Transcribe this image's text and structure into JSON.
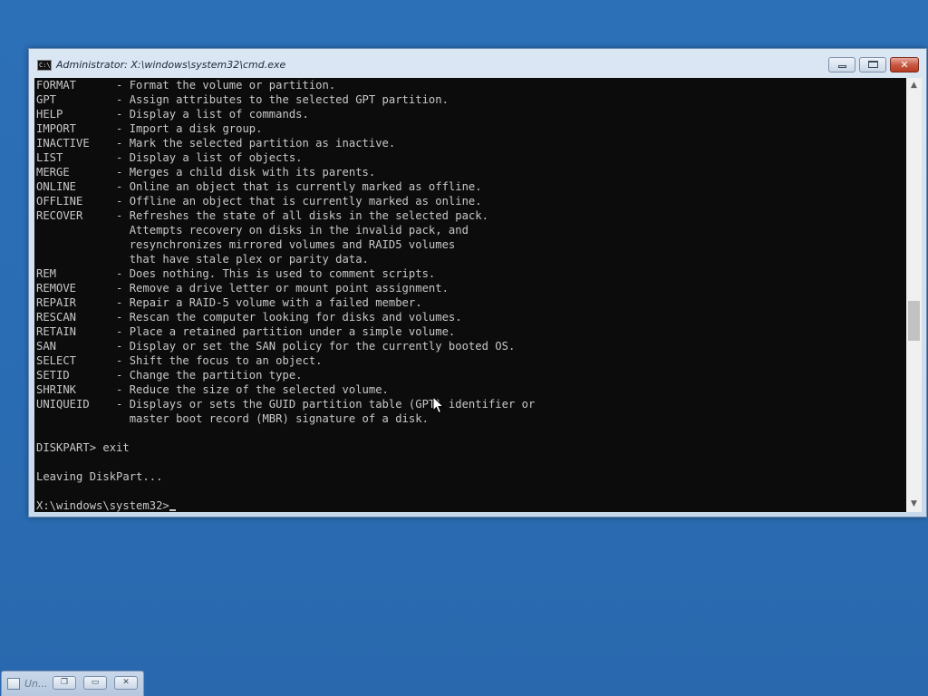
{
  "window": {
    "title": "Administrator: X:\\windows\\system32\\cmd.exe",
    "icon_label": "C:\\",
    "buttons": {
      "minimize": "minimize-icon",
      "maximize": "maximize-icon",
      "close": "✕"
    }
  },
  "console": {
    "text": "FORMAT      - Format the volume or partition.\nGPT         - Assign attributes to the selected GPT partition.\nHELP        - Display a list of commands.\nIMPORT      - Import a disk group.\nINACTIVE    - Mark the selected partition as inactive.\nLIST        - Display a list of objects.\nMERGE       - Merges a child disk with its parents.\nONLINE      - Online an object that is currently marked as offline.\nOFFLINE     - Offline an object that is currently marked as online.\nRECOVER     - Refreshes the state of all disks in the selected pack.\n              Attempts recovery on disks in the invalid pack, and\n              resynchronizes mirrored volumes and RAID5 volumes\n              that have stale plex or parity data.\nREM         - Does nothing. This is used to comment scripts.\nREMOVE      - Remove a drive letter or mount point assignment.\nREPAIR      - Repair a RAID-5 volume with a failed member.\nRESCAN      - Rescan the computer looking for disks and volumes.\nRETAIN      - Place a retained partition under a simple volume.\nSAN         - Display or set the SAN policy for the currently booted OS.\nSELECT      - Shift the focus to an object.\nSETID       - Change the partition type.\nSHRINK      - Reduce the size of the selected volume.\nUNIQUEID    - Displays or sets the GUID partition table (GPT) identifier or\n              master boot record (MBR) signature of a disk.\n\nDISKPART> exit\n\nLeaving DiskPart...\n\nX:\\windows\\system32>"
  },
  "scrollbar": {
    "up_arrow": "▲",
    "down_arrow": "▼"
  },
  "minimized_window": {
    "title": "Un..."
  },
  "colors": {
    "desktop": "#2a6db5",
    "console_bg": "#0c0c0c",
    "console_fg": "#c8c8c8",
    "close_button": "#c75a43"
  }
}
